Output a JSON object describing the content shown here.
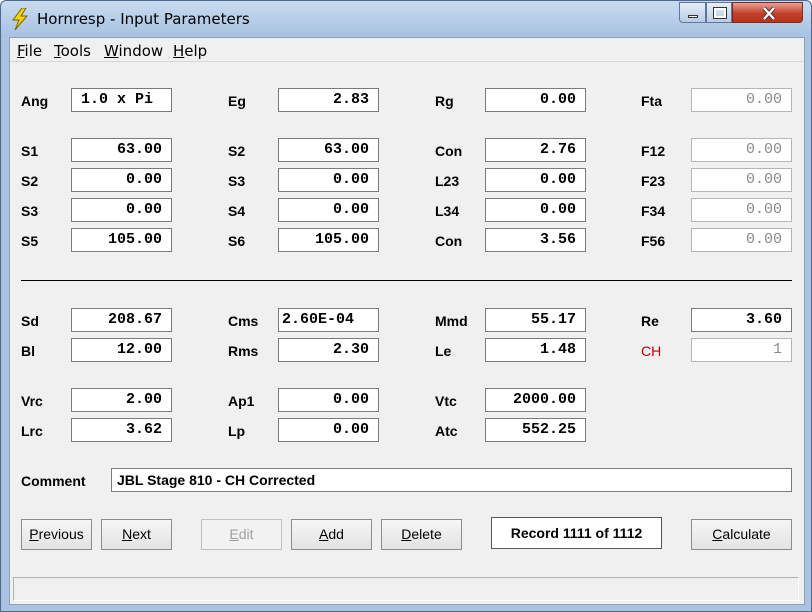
{
  "window": {
    "title": "Hornresp - Input Parameters",
    "icon": "lightning-bolt-icon"
  },
  "menu": [
    {
      "label": "File",
      "key": "F",
      "rest": "ile"
    },
    {
      "label": "Tools",
      "key": "T",
      "rest": "ools"
    },
    {
      "label": "Window",
      "key": "W",
      "rest": "indow"
    },
    {
      "label": "Help",
      "key": "H",
      "rest": "elp"
    }
  ],
  "params": {
    "ang": {
      "label": "Ang",
      "value": "1.0 x Pi"
    },
    "eg": {
      "label": "Eg",
      "value": "2.83"
    },
    "rg": {
      "label": "Rg",
      "value": "0.00"
    },
    "fta": {
      "label": "Fta",
      "value": "0.00"
    },
    "s1": {
      "label": "S1",
      "value": "63.00"
    },
    "s2a": {
      "label": "S2",
      "value": "63.00"
    },
    "con1": {
      "label": "Con",
      "value": "2.76"
    },
    "f12": {
      "label": "F12",
      "value": "0.00"
    },
    "s2b": {
      "label": "S2",
      "value": "0.00"
    },
    "s3a": {
      "label": "S3",
      "value": "0.00"
    },
    "l23": {
      "label": "L23",
      "value": "0.00"
    },
    "f23": {
      "label": "F23",
      "value": "0.00"
    },
    "s3b": {
      "label": "S3",
      "value": "0.00"
    },
    "s4": {
      "label": "S4",
      "value": "0.00"
    },
    "l34": {
      "label": "L34",
      "value": "0.00"
    },
    "f34": {
      "label": "F34",
      "value": "0.00"
    },
    "s5": {
      "label": "S5",
      "value": "105.00"
    },
    "s6": {
      "label": "S6",
      "value": "105.00"
    },
    "con2": {
      "label": "Con",
      "value": "3.56"
    },
    "f56": {
      "label": "F56",
      "value": "0.00"
    },
    "sd": {
      "label": "Sd",
      "value": "208.67"
    },
    "cms": {
      "label": "Cms",
      "value": "2.60E-04"
    },
    "mmd": {
      "label": "Mmd",
      "value": "55.17"
    },
    "re": {
      "label": "Re",
      "value": "3.60"
    },
    "bl": {
      "label": "Bl",
      "value": "12.00"
    },
    "rms": {
      "label": "Rms",
      "value": "2.30"
    },
    "le": {
      "label": "Le",
      "value": "1.48"
    },
    "ch": {
      "label": "CH",
      "value": "1"
    },
    "vrc": {
      "label": "Vrc",
      "value": "2.00"
    },
    "ap1": {
      "label": "Ap1",
      "value": "0.00"
    },
    "vtc": {
      "label": "Vtc",
      "value": "2000.00"
    },
    "lrc": {
      "label": "Lrc",
      "value": "3.62"
    },
    "lp": {
      "label": "Lp",
      "value": "0.00"
    },
    "atc": {
      "label": "Atc",
      "value": "552.25"
    }
  },
  "comment": {
    "label": "Comment",
    "value": "JBL Stage 810 - CH Corrected"
  },
  "buttons": {
    "previous": {
      "key": "P",
      "rest": "revious"
    },
    "next": {
      "key": "N",
      "rest": "ext"
    },
    "edit": {
      "key": "E",
      "rest": "dit"
    },
    "add": {
      "key": "A",
      "rest": "dd"
    },
    "delete": {
      "key": "D",
      "rest": "elete"
    },
    "calculate": {
      "key": "C",
      "rest": "alculate"
    }
  },
  "record": "Record 1111 of 1112",
  "colors": {
    "accent_label": "#c00000",
    "title_bar": "#a9c3e0",
    "close_button": "#c4402a"
  }
}
